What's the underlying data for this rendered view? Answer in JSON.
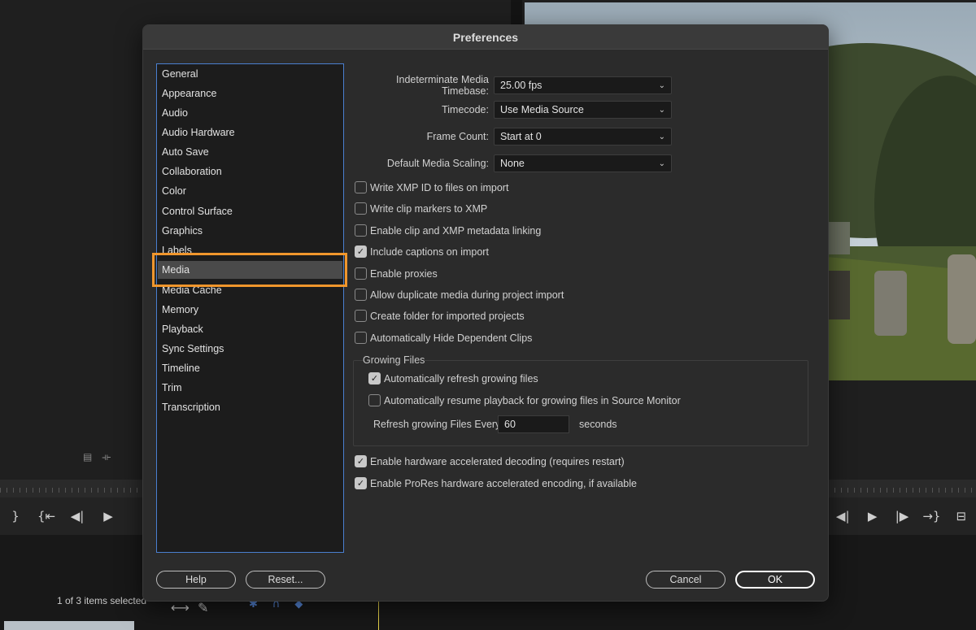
{
  "background": {
    "items_selected": "1 of 3 items selected"
  },
  "dialog": {
    "title": "Preferences",
    "sidebar": {
      "items": [
        {
          "label": "General"
        },
        {
          "label": "Appearance"
        },
        {
          "label": "Audio"
        },
        {
          "label": "Audio Hardware"
        },
        {
          "label": "Auto Save"
        },
        {
          "label": "Collaboration"
        },
        {
          "label": "Color"
        },
        {
          "label": "Control Surface"
        },
        {
          "label": "Graphics"
        },
        {
          "label": "Labels"
        },
        {
          "label": "Media"
        },
        {
          "label": "Media Cache"
        },
        {
          "label": "Memory"
        },
        {
          "label": "Playback"
        },
        {
          "label": "Sync Settings"
        },
        {
          "label": "Timeline"
        },
        {
          "label": "Trim"
        },
        {
          "label": "Transcription"
        }
      ],
      "selected": "Media"
    },
    "fields": {
      "timebase": {
        "label": "Indeterminate Media Timebase:",
        "value": "25.00 fps"
      },
      "timecode": {
        "label": "Timecode:",
        "value": "Use Media Source"
      },
      "frame_count": {
        "label": "Frame Count:",
        "value": "Start at 0"
      },
      "scaling": {
        "label": "Default Media Scaling:",
        "value": "None"
      }
    },
    "checkboxes": [
      {
        "label": "Write XMP ID to files on import",
        "checked": false
      },
      {
        "label": "Write clip markers to XMP",
        "checked": false
      },
      {
        "label": "Enable clip and XMP metadata linking",
        "checked": false
      },
      {
        "label": "Include captions on import",
        "checked": true
      },
      {
        "label": "Enable proxies",
        "checked": false
      },
      {
        "label": "Allow duplicate media during project import",
        "checked": false
      },
      {
        "label": "Create folder for imported projects",
        "checked": false
      },
      {
        "label": "Automatically Hide Dependent Clips",
        "checked": false
      }
    ],
    "growing_files": {
      "title": "Growing Files",
      "auto_refresh": {
        "label": "Automatically refresh growing files",
        "checked": true
      },
      "auto_resume": {
        "label": "Automatically resume playback for growing files in Source Monitor",
        "checked": false
      },
      "refresh_label": "Refresh growing Files Every",
      "refresh_value": "60",
      "refresh_unit": "seconds"
    },
    "hardware": [
      {
        "label": "Enable hardware accelerated decoding (requires restart)",
        "checked": true
      },
      {
        "label": "Enable ProRes hardware accelerated encoding, if available",
        "checked": true
      }
    ],
    "buttons": {
      "help": "Help",
      "reset": "Reset...",
      "cancel": "Cancel",
      "ok": "OK"
    }
  },
  "colors": {
    "highlight": "#f0962c",
    "sidebar_border": "#4a7fd0"
  }
}
